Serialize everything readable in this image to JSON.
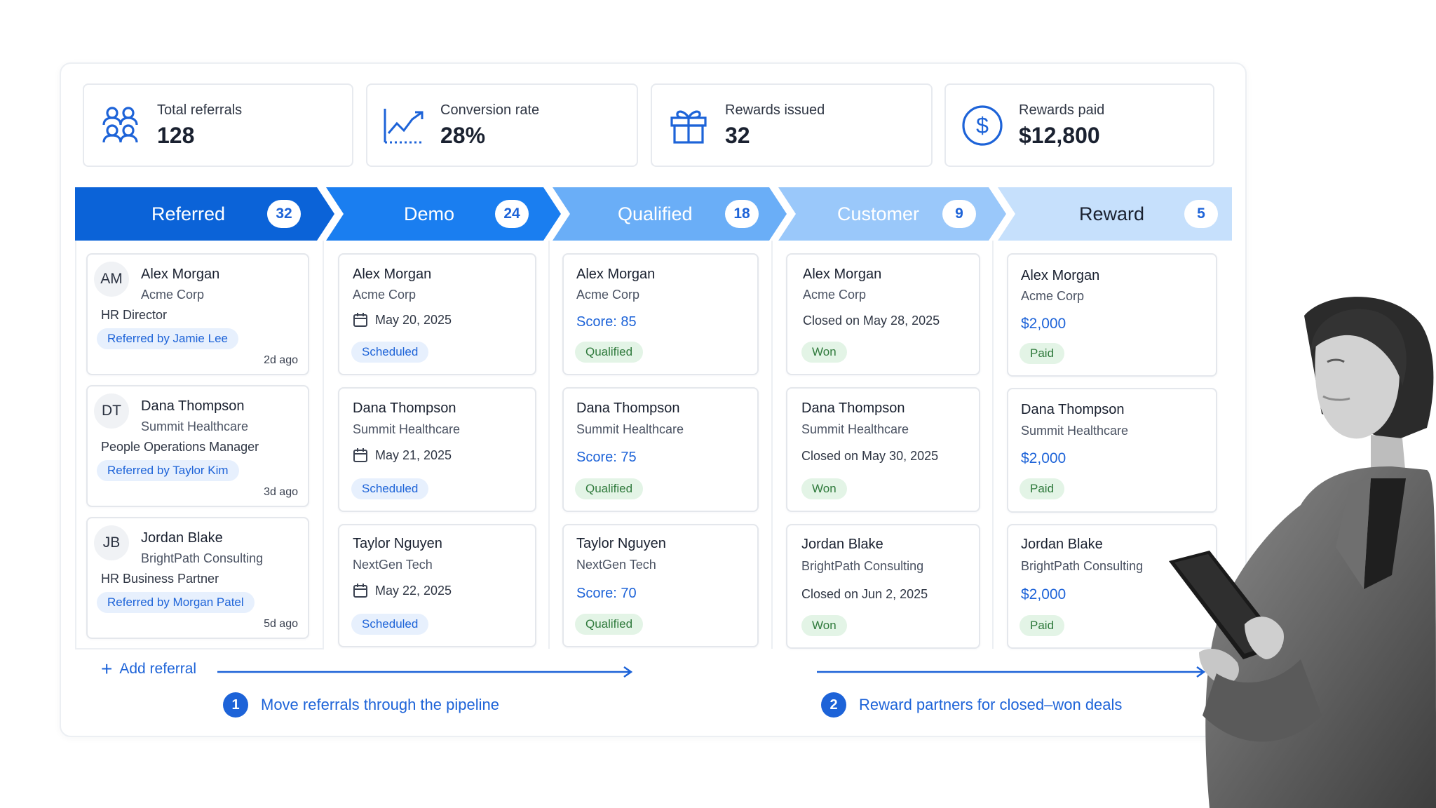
{
  "stats": [
    {
      "label": "Total referrals",
      "value": "128",
      "icon": "users-icon"
    },
    {
      "label": "Conversion rate",
      "value": "28%",
      "icon": "trend-up-icon"
    },
    {
      "label": "Rewards issued",
      "value": "32",
      "icon": "gift-icon"
    },
    {
      "label": "Rewards paid",
      "value": "$12,800",
      "icon": "dollar-icon"
    }
  ],
  "stages": [
    {
      "label": "Referred",
      "count": "32",
      "color": "#0b63d8"
    },
    {
      "label": "Demo",
      "count": "24",
      "color": "#1a7ef0"
    },
    {
      "label": "Qualified",
      "count": "18",
      "color": "#6aaef7"
    },
    {
      "label": "Customer",
      "count": "9",
      "color": "#9ac8fa"
    },
    {
      "label": "Reward",
      "count": "5",
      "color": "#c6e0fc"
    }
  ],
  "referred": [
    {
      "initials": "AM",
      "name": "Alex Morgan",
      "company": "Acme Corp",
      "role": "HR Director",
      "referrer": "Referred by Jamie Lee",
      "ago": "2d ago"
    },
    {
      "initials": "DT",
      "name": "Dana Thompson",
      "company": "Summit Healthcare",
      "role": "People Operations Manager",
      "referrer": "Referred by Taylor Kim",
      "ago": "3d ago"
    },
    {
      "initials": "JB",
      "name": "Jordan Blake",
      "company": "BrightPath Consulting",
      "role": "HR Business Partner",
      "referrer": "Referred by Morgan Patel",
      "ago": "5d ago"
    }
  ],
  "demo": [
    {
      "name": "Alex Morgan",
      "company": "Acme Corp",
      "date": "May 20, 2025",
      "status": "Scheduled"
    },
    {
      "name": "Dana Thompson",
      "company": "Summit Healthcare",
      "date": "May 21, 2025",
      "status": "Scheduled"
    },
    {
      "name": "Taylor Nguyen",
      "company": "NextGen Tech",
      "date": "May 22, 2025",
      "status": "Scheduled"
    }
  ],
  "qualified": [
    {
      "name": "Alex Morgan",
      "company": "Acme Corp",
      "score": "Score: 85",
      "status": "Qualified"
    },
    {
      "name": "Dana Thompson",
      "company": "Summit Healthcare",
      "score": "Score: 75",
      "status": "Qualified"
    },
    {
      "name": "Taylor Nguyen",
      "company": "NextGen Tech",
      "score": "Score: 70",
      "status": "Qualified"
    }
  ],
  "customer": [
    {
      "name": "Alex Morgan",
      "company": "Acme Corp",
      "closed": "Closed on May 28, 2025",
      "status": "Won"
    },
    {
      "name": "Dana Thompson",
      "company": "Summit Healthcare",
      "closed": "Closed on May 30, 2025",
      "status": "Won"
    },
    {
      "name": "Jordan Blake",
      "company": "BrightPath Consulting",
      "closed": "Closed on Jun 2, 2025",
      "status": "Won"
    }
  ],
  "reward": [
    {
      "name": "Alex Morgan",
      "company": "Acme Corp",
      "amount": "$2,000",
      "status": "Paid"
    },
    {
      "name": "Dana Thompson",
      "company": "Summit Healthcare",
      "amount": "$2,000",
      "status": "Paid"
    },
    {
      "name": "Jordan Blake",
      "company": "BrightPath Consulting",
      "amount": "$2,000",
      "status": "Paid"
    }
  ],
  "add_referral": "Add referral",
  "steps": [
    {
      "num": "1",
      "text": "Move referrals through the pipeline"
    },
    {
      "num": "2",
      "text": "Reward partners for closed–won deals"
    }
  ]
}
